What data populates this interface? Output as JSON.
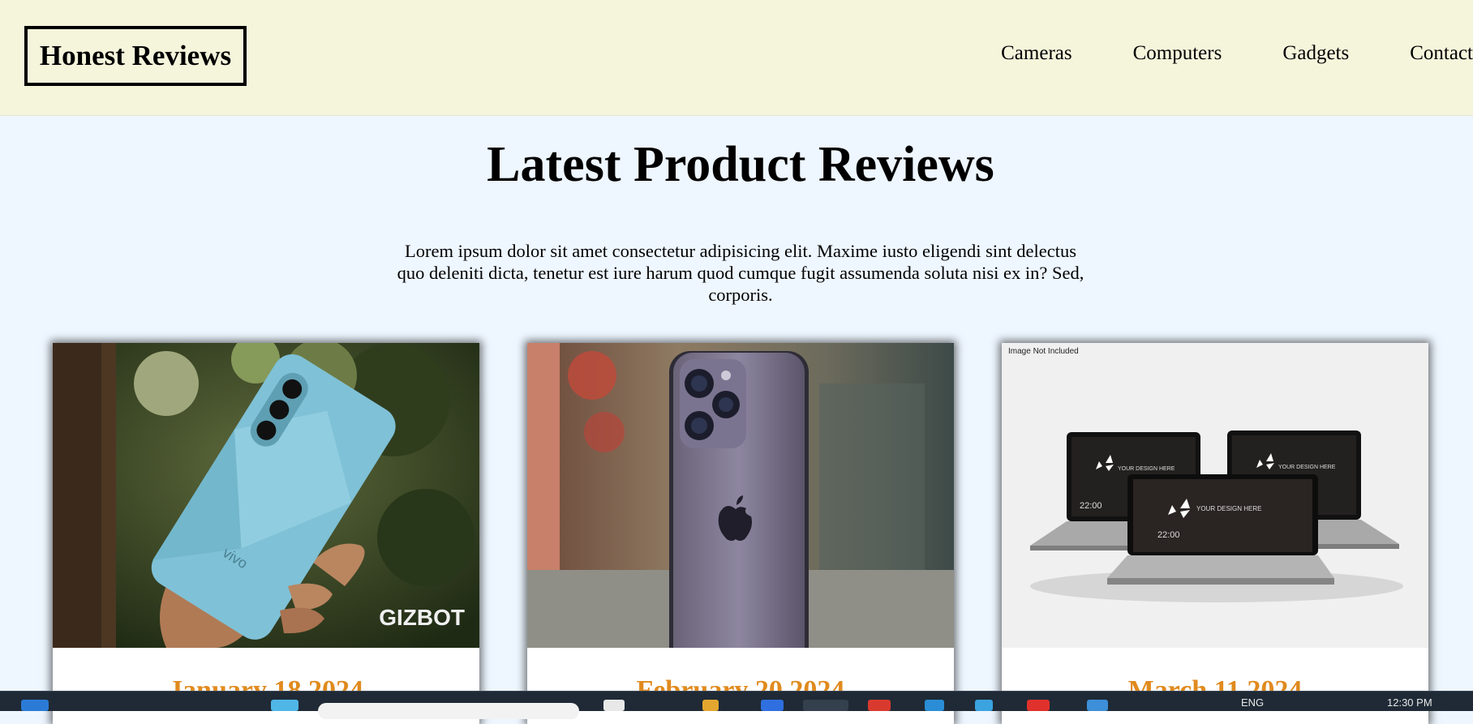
{
  "header": {
    "logo": "Honest Reviews",
    "nav": [
      "Cameras",
      "Computers",
      "Gadgets",
      "Contact"
    ]
  },
  "main": {
    "title": "Latest Product Reviews",
    "intro_lines": [
      "Lorem ipsum dolor sit amet consectetur adipisicing elit. Maxime iusto eligendi sint delectus",
      "quo deleniti dicta, tenetur est iure harum quod cumque fugit assumenda soluta nisi ex in? Sed,",
      "corporis."
    ]
  },
  "cards": [
    {
      "date": "January 18 2024",
      "image_text": "GIZBOT",
      "phone_text": "vivo"
    },
    {
      "date": "February 20 2024"
    },
    {
      "date": "March 11 2024",
      "image_note": "Image Not Included",
      "screen_text": "YOUR DESIGN HERE",
      "clock": "22:00"
    }
  ],
  "taskbar": {
    "lang": "ENG",
    "time": "12:30 PM"
  },
  "colors": {
    "header_bg": "#f5f5dc",
    "page_bg": "#eef6ff",
    "date_accent": "#e08a1e"
  }
}
